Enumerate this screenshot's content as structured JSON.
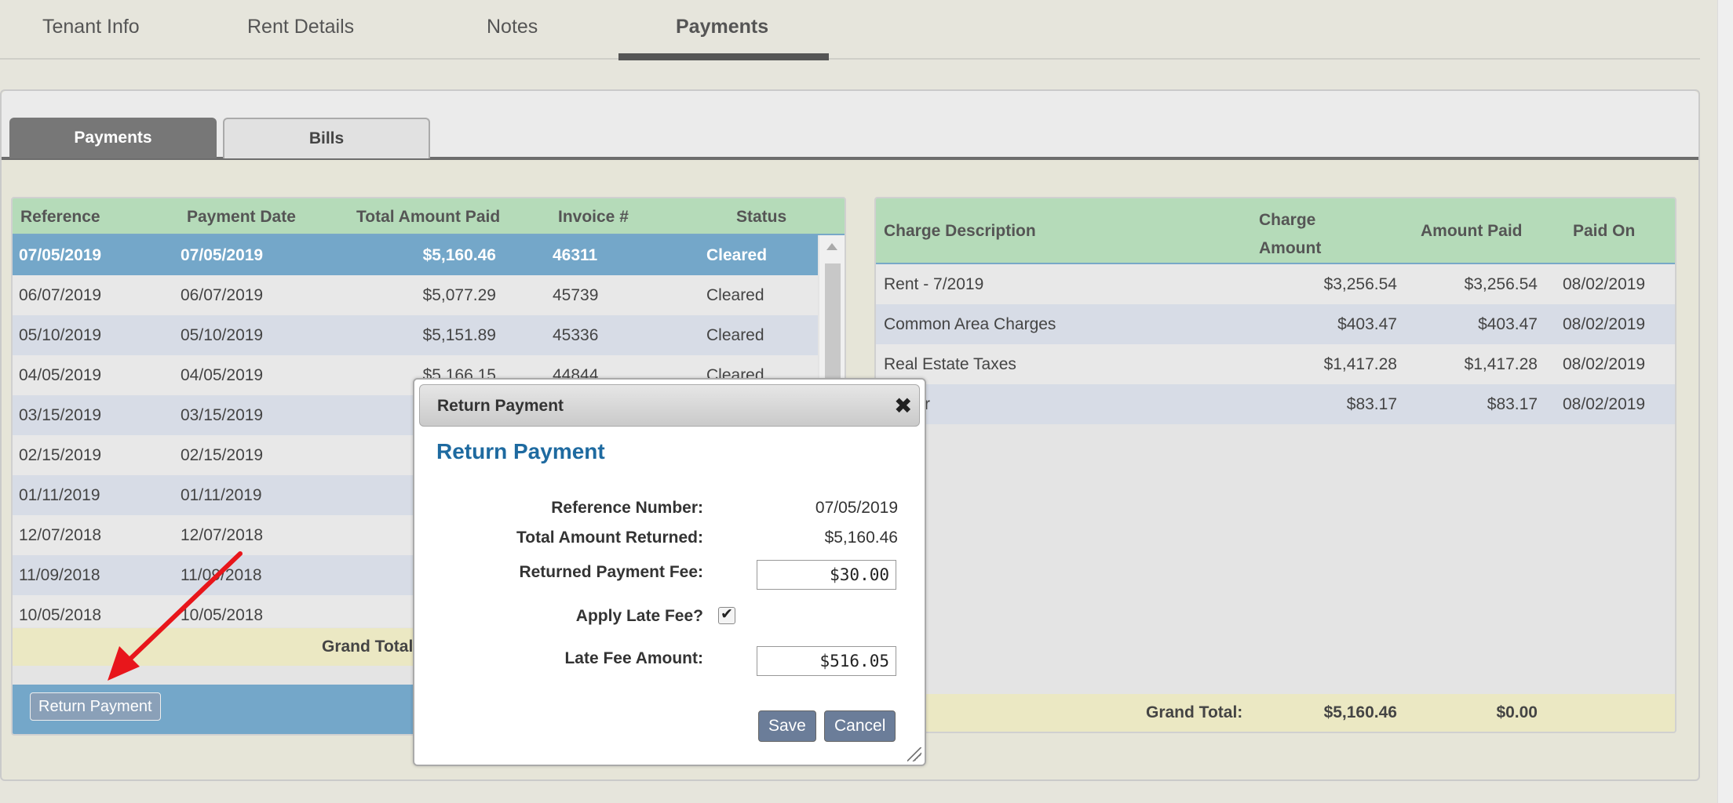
{
  "top_tabs": [
    {
      "label": "Tenant Info"
    },
    {
      "label": "Rent Details"
    },
    {
      "label": "Notes"
    },
    {
      "label": "Payments",
      "active": true
    }
  ],
  "sub_tabs": [
    {
      "label": "Payments",
      "active": true
    },
    {
      "label": "Bills"
    }
  ],
  "payments_table": {
    "headers": [
      "Reference",
      "Payment Date",
      "Total Amount Paid",
      "Invoice #",
      "Status"
    ],
    "rows": [
      {
        "reference": "07/05/2019",
        "date": "07/05/2019",
        "amount": "$5,160.46",
        "invoice": "46311",
        "status": "Cleared",
        "selected": true
      },
      {
        "reference": "06/07/2019",
        "date": "06/07/2019",
        "amount": "$5,077.29",
        "invoice": "45739",
        "status": "Cleared"
      },
      {
        "reference": "05/10/2019",
        "date": "05/10/2019",
        "amount": "$5,151.89",
        "invoice": "45336",
        "status": "Cleared"
      },
      {
        "reference": "04/05/2019",
        "date": "04/05/2019",
        "amount": "$5,166.15",
        "invoice": "44844",
        "status": "Cleared"
      },
      {
        "reference": "03/15/2019",
        "date": "03/15/2019",
        "amount": "",
        "invoice": "",
        "status": ""
      },
      {
        "reference": "02/15/2019",
        "date": "02/15/2019",
        "amount": "",
        "invoice": "",
        "status": ""
      },
      {
        "reference": "01/11/2019",
        "date": "01/11/2019",
        "amount": "",
        "invoice": "",
        "status": ""
      },
      {
        "reference": "12/07/2018",
        "date": "12/07/2018",
        "amount": "",
        "invoice": "",
        "status": ""
      },
      {
        "reference": "11/09/2018",
        "date": "11/09/2018",
        "amount": "",
        "invoice": "",
        "status": ""
      },
      {
        "reference": "10/05/2018",
        "date": "10/05/2018",
        "amount": "",
        "invoice": "",
        "status": ""
      }
    ],
    "grand_total_label": "Grand Total",
    "return_button": "Return Payment"
  },
  "charges_table": {
    "headers": {
      "description": "Charge Description",
      "charge_amount": "Charge Amount",
      "amount_paid": "Amount Paid",
      "paid_on": "Paid On"
    },
    "rows": [
      {
        "description": "Rent - 7/2019",
        "charge": "$3,256.54",
        "paid": "$3,256.54",
        "paid_on": "08/02/2019"
      },
      {
        "description": "Common Area Charges",
        "charge": "$403.47",
        "paid": "$403.47",
        "paid_on": "08/02/2019"
      },
      {
        "description": "Real Estate Taxes",
        "charge": "$1,417.28",
        "paid": "$1,417.28",
        "paid_on": "08/02/2019"
      },
      {
        "description": "r",
        "charge": "$83.17",
        "paid": "$83.17",
        "paid_on": "08/02/2019"
      }
    ],
    "grand_total_label": "Grand Total:",
    "grand_total_charge": "$5,160.46",
    "grand_total_paid": "$0.00"
  },
  "modal": {
    "title_bar": "Return Payment",
    "heading": "Return Payment",
    "reference_label": "Reference Number:",
    "reference_value": "07/05/2019",
    "total_returned_label": "Total Amount Returned:",
    "total_returned_value": "$5,160.46",
    "fee_label": "Returned Payment Fee:",
    "fee_value": "$30.00",
    "apply_late_fee_label": "Apply Late Fee?",
    "apply_late_fee_checked": true,
    "late_fee_label": "Late Fee Amount:",
    "late_fee_value": "$516.05",
    "save_button": "Save",
    "cancel_button": "Cancel"
  },
  "icons": {
    "close": "close-icon",
    "checkbox": "checkmark-icon",
    "resize": "resize-grip-icon"
  },
  "colors": {
    "header_green": "#b5dbb9",
    "selected_blue": "#74a7c9",
    "heading_blue": "#1e6aa0",
    "annotation_red": "#e8161b"
  }
}
